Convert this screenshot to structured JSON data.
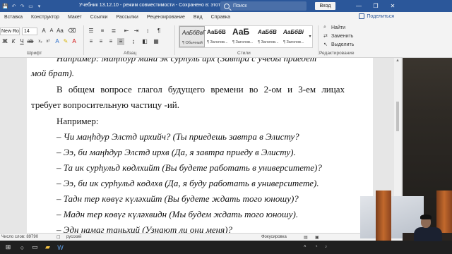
{
  "titlebar": {
    "doc_title": "Учебник 13.12.10  -  режим совместимости  -  Сохранено в: этот компьютер",
    "search_placeholder": "Поиск",
    "signin_label": "Вход"
  },
  "ribbon_tabs": [
    "Вставка",
    "Конструктор",
    "Макет",
    "Ссылки",
    "Рассылки",
    "Рецензирование",
    "Вид",
    "Справка"
  ],
  "share_label": "Поделиться",
  "font": {
    "name": "New Rom",
    "size": "14"
  },
  "groups": {
    "font": "Шрифт",
    "paragraph": "Абзац",
    "styles": "Стили",
    "editing": "Редактирование"
  },
  "styles": [
    {
      "sample": "АаБбВвГ",
      "name": "¶ Обычный"
    },
    {
      "sample": "АаБбВ",
      "name": "¶ Заголов..."
    },
    {
      "sample": "АаБ",
      "name": "¶ Заголов..."
    },
    {
      "sample": "АаБбВ",
      "name": "¶ Заголов..."
    },
    {
      "sample": "АаБбВі",
      "name": "¶ Заголов..."
    }
  ],
  "editing": {
    "find": "Найти",
    "replace": "Заменить",
    "select": "Выделить"
  },
  "document": {
    "lines": [
      {
        "text": "Например: Маңһдур мини эк сурһуль ирх (Завтра с учебы приедет",
        "style": "top"
      },
      {
        "text": "мой брат).",
        "style": "ital"
      },
      {
        "text": "В общем вопросе глагол будущего времени во 2-ом и 3-ем лицах",
        "style": "just-indent"
      },
      {
        "text": "требует вопросительную частицу -ий.",
        "style": "normal"
      },
      {
        "text": "Например:",
        "style": "indent"
      },
      {
        "text": "– Чи маңһдур Элстд ирхийч? (Ты приедешь завтра в Элисту?",
        "style": "ital-indent"
      },
      {
        "text": "– Ээ, би маңһдур Элстд ирхв (Да, я завтра приеду в Элисту).",
        "style": "ital-indent"
      },
      {
        "text": "– Та ик сурһульд көдлхийт (Вы будете работать в университете)?",
        "style": "ital-indent"
      },
      {
        "text": "– Ээ, би ик сурһульд көдлхв (Да, я буду работать в университете).",
        "style": "ital-indent"
      },
      {
        "text": "– Тадн тер көвүг күләхийт (Вы будете ждать того юношу)?",
        "style": "ital-indent"
      },
      {
        "text": "– Мадн тер көвүг күләхвидн (Мы будем ждать того юношу).",
        "style": "ital-indent"
      },
      {
        "text": "– Эдн намаг таньхий (Узнают ли они меня)?",
        "style": "ital-indent"
      }
    ]
  },
  "status": {
    "words": "Число слов: 89790",
    "lang": "русский",
    "focus": "Фокусировка"
  },
  "colors": {
    "titlebar": "#2b579a",
    "ribbon": "#f3f3f3",
    "taskbar": "#202020"
  }
}
